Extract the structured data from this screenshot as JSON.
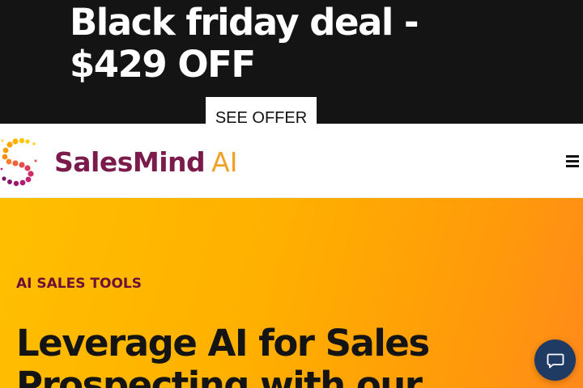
{
  "promo": {
    "title": "Black friday deal - $429 OFF",
    "cta_label": "SEE OFFER"
  },
  "header": {
    "logo_name": "SalesMind",
    "logo_suffix": "AI",
    "menu_icon": "hamburger-menu-icon"
  },
  "hero": {
    "eyebrow": "AI SALES TOOLS",
    "title": "Leverage AI for Sales Prospecting with our"
  },
  "chat_widget": {
    "icon": "chat-bubble-icon"
  },
  "colors": {
    "banner_bg": "#141414",
    "brand_primary": "#7a1b4c",
    "brand_accent": "#f2a126",
    "hero_gradient_start": "#ffbf00",
    "hero_gradient_end": "#ff8a1a",
    "chat_button": "#1f3a63"
  }
}
